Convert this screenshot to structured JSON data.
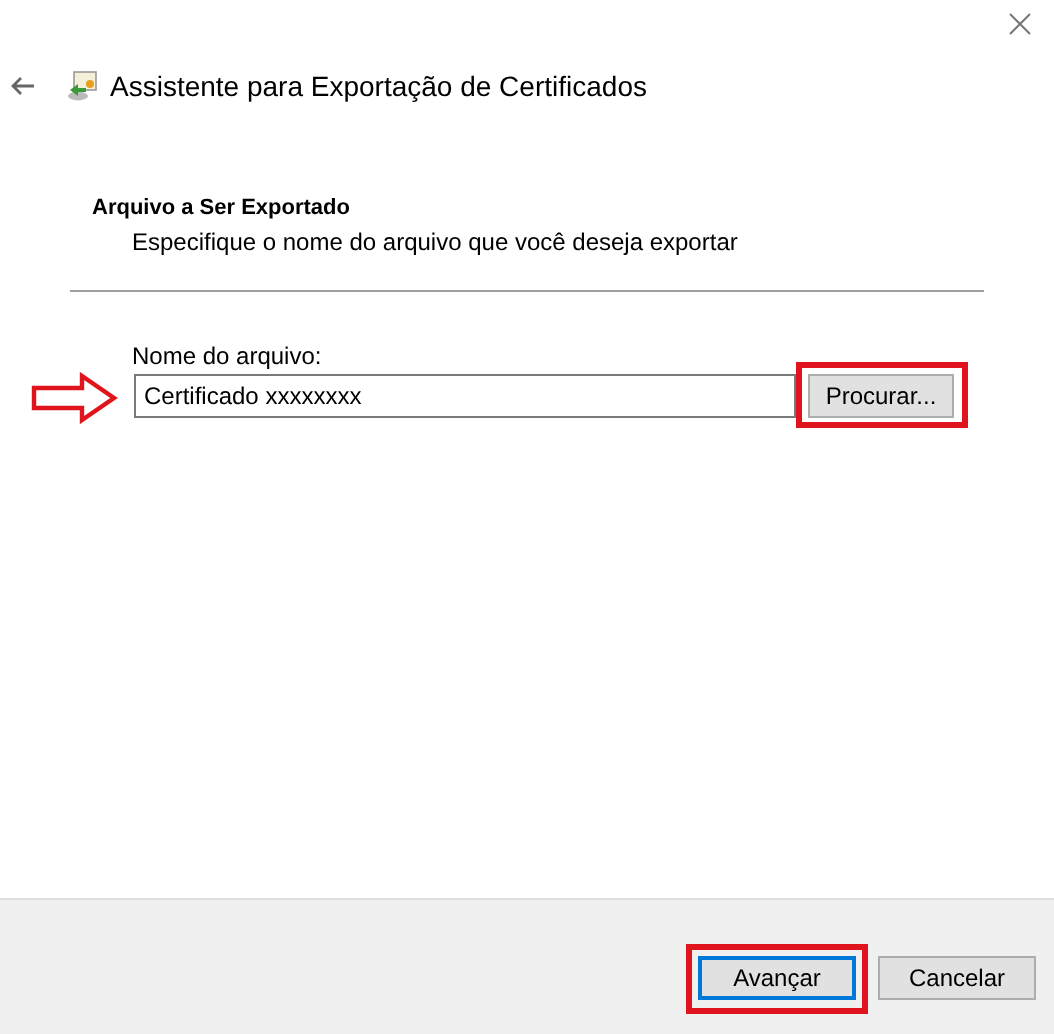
{
  "window": {
    "title": "Assistente para Exportação de Certificados"
  },
  "page": {
    "heading": "Arquivo a Ser Exportado",
    "subtitle": "Especifique o nome do arquivo que você deseja exportar"
  },
  "file_field": {
    "label": "Nome do arquivo:",
    "value": "Certificado xxxxxxxx",
    "arrow_marked": true
  },
  "browse_button": {
    "label": "Procurar...",
    "highlighted": true
  },
  "buttons": [
    {
      "label": "Avançar",
      "default": true,
      "highlighted": true
    },
    {
      "label": "Cancelar",
      "default": false,
      "highlighted": false
    }
  ]
}
